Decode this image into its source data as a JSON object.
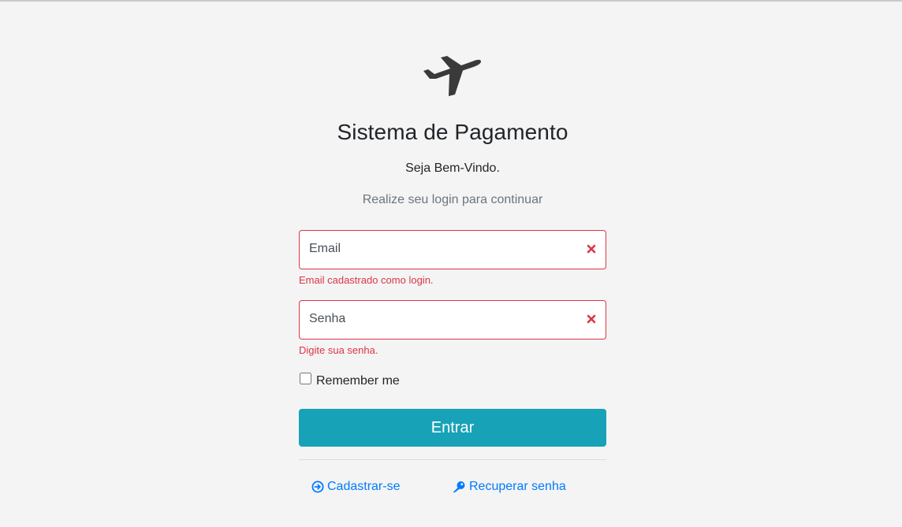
{
  "header": {
    "logo_icon": "plane-icon",
    "title": "Sistema de Pagamento",
    "welcome": "Seja Bem-Vindo.",
    "subtitle": "Realize seu login para continuar"
  },
  "form": {
    "email": {
      "placeholder": "Email",
      "value": "",
      "feedback": "Email cadastrado como login.",
      "status": "invalid"
    },
    "password": {
      "placeholder": "Senha",
      "value": "",
      "feedback": "Digite sua senha.",
      "status": "invalid"
    },
    "remember": {
      "label": "Remember me",
      "checked": false
    },
    "submit_label": "Entrar"
  },
  "links": {
    "register": {
      "icon": "arrow-circle-right-icon",
      "label": "Cadastrar-se"
    },
    "recover": {
      "icon": "key-icon",
      "label": "Recuperar senha"
    }
  },
  "colors": {
    "background": "#f4f4f4",
    "error": "#dc3545",
    "primary_button": "#17a2b8",
    "link": "#007bff",
    "muted_text": "#6c757d"
  }
}
